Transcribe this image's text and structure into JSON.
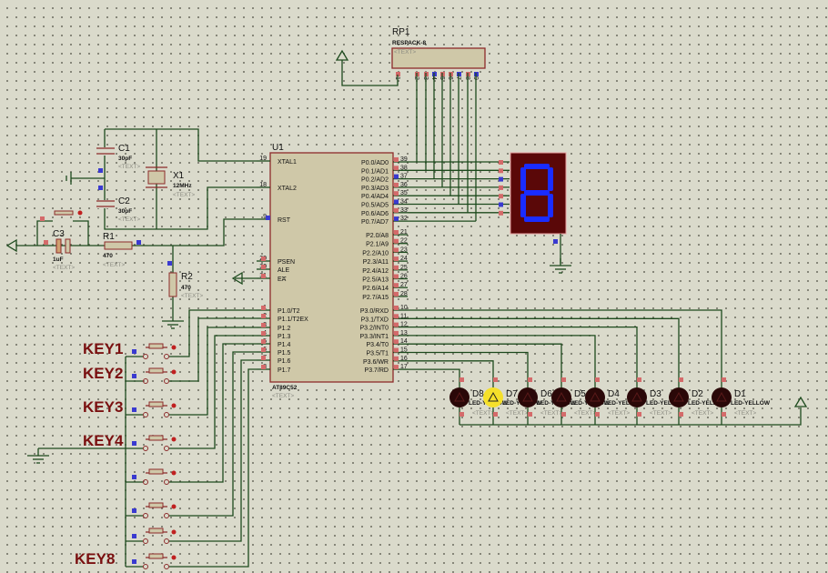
{
  "u1": {
    "ref": "U1",
    "part": "AT89C52",
    "text": "<TEXT>",
    "left_pins": [
      {
        "num": "19",
        "name": "XTAL1"
      },
      {
        "num": "18",
        "name": "XTAL2"
      },
      {
        "num": "9",
        "name": "RST"
      },
      {
        "num": "29",
        "name": "PSEN",
        "overbar": true
      },
      {
        "num": "30",
        "name": "ALE"
      },
      {
        "num": "31",
        "name": "EA",
        "overbar": true
      },
      {
        "num": "1",
        "name": "P1.0/T2"
      },
      {
        "num": "2",
        "name": "P1.1/T2EX"
      },
      {
        "num": "3",
        "name": "P1.2"
      },
      {
        "num": "4",
        "name": "P1.3"
      },
      {
        "num": "5",
        "name": "P1.4"
      },
      {
        "num": "6",
        "name": "P1.5"
      },
      {
        "num": "7",
        "name": "P1.6"
      },
      {
        "num": "8",
        "name": "P1.7"
      }
    ],
    "port0": [
      {
        "num": "39",
        "name": "P0.0/AD0"
      },
      {
        "num": "38",
        "name": "P0.1/AD1"
      },
      {
        "num": "37",
        "name": "P0.2/AD2"
      },
      {
        "num": "36",
        "name": "P0.3/AD3"
      },
      {
        "num": "35",
        "name": "P0.4/AD4"
      },
      {
        "num": "34",
        "name": "P0.5/AD5"
      },
      {
        "num": "33",
        "name": "P0.6/AD6"
      },
      {
        "num": "32",
        "name": "P0.7/AD7"
      }
    ],
    "port2": [
      {
        "num": "21",
        "name": "P2.0/A8"
      },
      {
        "num": "22",
        "name": "P2.1/A9"
      },
      {
        "num": "23",
        "name": "P2.2/A10"
      },
      {
        "num": "24",
        "name": "P2.3/A11"
      },
      {
        "num": "25",
        "name": "P2.4/A12"
      },
      {
        "num": "26",
        "name": "P2.5/A13"
      },
      {
        "num": "27",
        "name": "P2.6/A14"
      },
      {
        "num": "28",
        "name": "P2.7/A15"
      }
    ],
    "port3": [
      {
        "num": "10",
        "name": "P3.0/RXD"
      },
      {
        "num": "11",
        "name": "P3.1/TXD"
      },
      {
        "num": "12",
        "name": "P3.2/INT0"
      },
      {
        "num": "13",
        "name": "P3.3/INT1"
      },
      {
        "num": "14",
        "name": "P3.4/T0"
      },
      {
        "num": "15",
        "name": "P3.5/T1"
      },
      {
        "num": "16",
        "name": "P3.6/WR"
      },
      {
        "num": "17",
        "name": "P3.7/RD"
      }
    ]
  },
  "rp1": {
    "ref": "RP1",
    "part": "RESPACK-8",
    "text": "<TEXT>",
    "pins": [
      "1",
      "2",
      "3",
      "4",
      "5",
      "6",
      "7",
      "8",
      "9"
    ]
  },
  "c1": {
    "ref": "C1",
    "value": "30pF",
    "text": "<TEXT>"
  },
  "c2": {
    "ref": "C2",
    "value": "30pF",
    "text": "<TEXT>"
  },
  "c3": {
    "ref": "C3",
    "value": "1uF",
    "text": "<TEXT>"
  },
  "x1": {
    "ref": "X1",
    "value": "12MHz",
    "text": "<TEXT>"
  },
  "r1": {
    "ref": "R1",
    "value": "470",
    "text": "<TEXT>"
  },
  "r2": {
    "ref": "R2",
    "value": "470",
    "text": "<TEXT>"
  },
  "keys": [
    "KEY1",
    "KEY2",
    "KEY3",
    "KEY4",
    "",
    "",
    "",
    "KEY8"
  ],
  "leds": [
    {
      "ref": "D8",
      "part": "LED-YELLOW",
      "text": "<TEXT>",
      "lit": false
    },
    {
      "ref": "D7",
      "part": "LED-YELLOW",
      "text": "<TEXT>",
      "lit": true
    },
    {
      "ref": "D6",
      "part": "LED-YELLOW",
      "text": "<TEXT>",
      "lit": false
    },
    {
      "ref": "D5",
      "part": "LED-YELLOW",
      "text": "<TEXT>",
      "lit": false
    },
    {
      "ref": "D4",
      "part": "LED-YELLOW",
      "text": "<TEXT>",
      "lit": false
    },
    {
      "ref": "D3",
      "part": "LED-YELLOW",
      "text": "<TEXT>",
      "lit": false
    },
    {
      "ref": "D2",
      "part": "LED-YELLOW",
      "text": "<TEXT>",
      "lit": false
    },
    {
      "ref": "D1",
      "part": "LED-YELLOW",
      "text": "<TEXT>",
      "lit": false
    }
  ],
  "display": {
    "digit": "8",
    "segment_color": "#1a2cff",
    "body_color": "#5a0808"
  },
  "colors": {
    "wire": "#1d4a1d",
    "outline": "#8c2a2a",
    "body": "#cfc8a8",
    "background": "#dadacb",
    "led_lit": "#f5e02a",
    "led_off": "#2a0808"
  }
}
